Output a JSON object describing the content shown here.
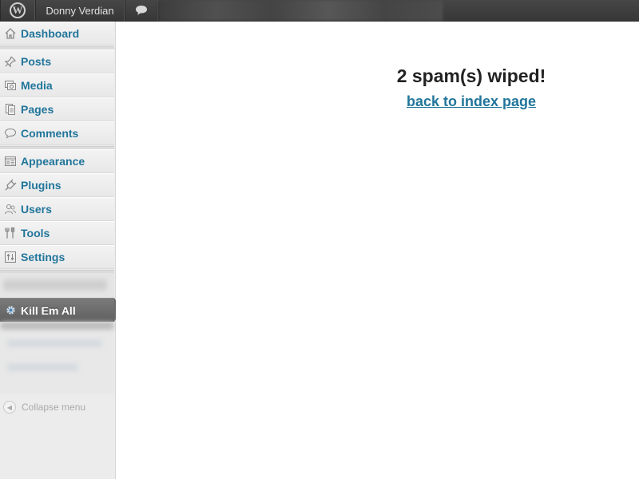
{
  "adminbar": {
    "logo_icon": "wordpress-logo-icon",
    "logo_glyph": "W",
    "user_name": "Donny Verdian",
    "comments_icon": "comment-bubble-icon"
  },
  "sidebar": {
    "items": [
      {
        "label": "Dashboard",
        "icon": "home-icon"
      },
      {
        "label": "Posts",
        "icon": "pushpin-icon"
      },
      {
        "label": "Media",
        "icon": "media-icon"
      },
      {
        "label": "Pages",
        "icon": "pages-icon"
      },
      {
        "label": "Comments",
        "icon": "comment-icon"
      },
      {
        "label": "Appearance",
        "icon": "appearance-icon"
      },
      {
        "label": "Plugins",
        "icon": "plug-icon"
      },
      {
        "label": "Users",
        "icon": "users-icon"
      },
      {
        "label": "Tools",
        "icon": "tools-icon"
      },
      {
        "label": "Settings",
        "icon": "settings-icon"
      }
    ],
    "active_item": {
      "label": "Kill Em All",
      "icon": "gear-icon"
    },
    "collapse_label": "Collapse menu"
  },
  "main": {
    "message": "2 spam(s) wiped!",
    "back_link": "back to index page"
  },
  "colors": {
    "link": "#21759b",
    "adminbar": "#464646",
    "sidebar_bg": "#ececec",
    "active_bg": "#6a6a6a"
  }
}
